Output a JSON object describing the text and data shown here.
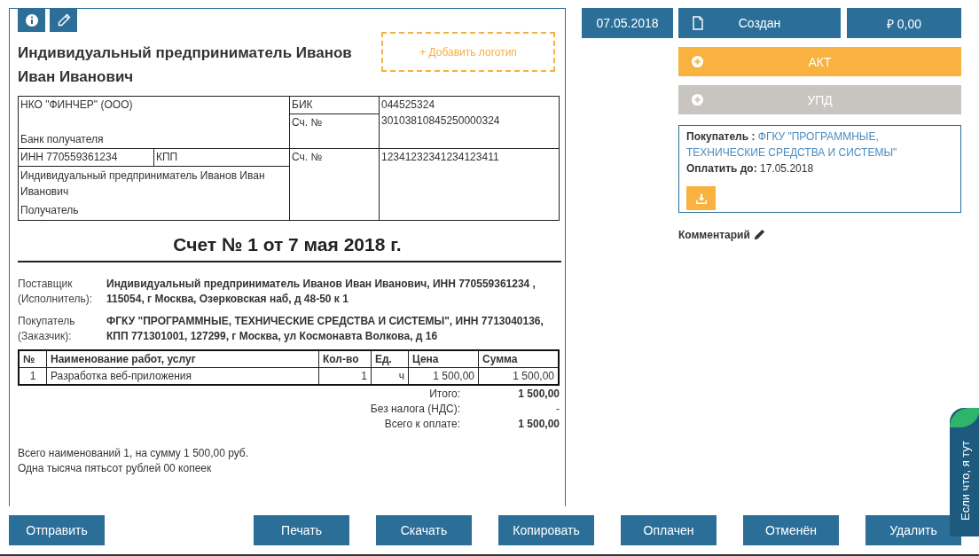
{
  "document": {
    "seller_name": "Индивидуальный предприниматель Иванов Иван Иванович",
    "logo_placeholder": "+ Добавить логотип",
    "bank": {
      "bank_name": "НКО \"ФИНЧЕР\" (ООО)",
      "bank_label": "Банк получателя",
      "bik_label": "БИК",
      "bik": "044525324",
      "corr_label": "Сч. №",
      "corr_account": "30103810845250000324",
      "inn": "ИНН 770559361234",
      "kpp": "КПП",
      "account_label": "Сч. №",
      "account": "12341232341234123411",
      "recipient": "Индивидуальный предприниматель Иванов Иван Иванович",
      "recipient_label": "Получатель"
    },
    "title": "Счет № 1 от 7 мая 2018 г.",
    "parties": [
      {
        "label": "Поставщик (Исполнитель):",
        "value": "Индивидуальный предприниматель Иванов Иван Иванович, ИНН 770559361234 , 115054, г Москва, Озерковская наб, д 48-50 к 1"
      },
      {
        "label": "Покупатель (Заказчик):",
        "value": "ФГКУ \"ПРОГРАММНЫЕ, ТЕХНИЧЕСКИЕ СРЕДСТВА И СИСТЕМЫ\", ИНН 7713040136, КПП 771301001, 127299, г Москва, ул Космонавта Волкова, д 16"
      }
    ],
    "items": {
      "columns": [
        "№",
        "Наименование работ, услуг",
        "Кол-во",
        "Ед.",
        "Цена",
        "Сумма"
      ],
      "rows": [
        [
          "1",
          "Разработка веб-приложения",
          "1",
          "ч",
          "1 500,00",
          "1 500,00"
        ]
      ]
    },
    "totals": [
      {
        "label": "Итого:",
        "value": "1 500,00",
        "strong": true
      },
      {
        "label": "Без налога (НДС):",
        "value": "-",
        "strong": false
      },
      {
        "label": "Всего к оплате:",
        "value": "1 500,00",
        "strong": true
      }
    ],
    "summary": [
      "Всего наименований 1, на сумму 1 500,00 руб.",
      "Одна тысяча пятьсот рублей 00 копеек"
    ]
  },
  "sidebar": {
    "date": "07.05.2018",
    "status": "Создан",
    "amount": "₽ 0,00",
    "actions": [
      {
        "label": "АКТ",
        "disabled": false
      },
      {
        "label": "УПД",
        "disabled": true
      }
    ],
    "buyer_label": "Покупатель :",
    "buyer": "ФГКУ \"ПРОГРАММНЫЕ, ТЕХНИЧЕСКИЕ СРЕДСТВА И СИСТЕМЫ\"",
    "due_label": "Оплатить до:",
    "due_date": "17.05.2018",
    "comment_label": "Комментарий"
  },
  "footer_buttons": [
    "Отправить",
    "Печать",
    "Скачать",
    "Копировать",
    "Оплачен",
    "Отменён",
    "Удалить"
  ],
  "chat_tab": "Если что, я тут"
}
